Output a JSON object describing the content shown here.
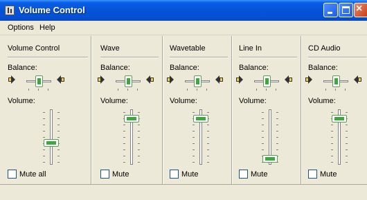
{
  "window": {
    "title": "Volume Control",
    "accent": "#0a5fe6",
    "icon": "speaker-app-icon"
  },
  "menu": {
    "items": [
      "Options",
      "Help"
    ]
  },
  "labels": {
    "balance": "Balance:",
    "volume": "Volume:"
  },
  "channels": [
    {
      "name": "Volume Control",
      "balance": 0.5,
      "volume": 0.38,
      "mute_label": "Mute all",
      "muted": false
    },
    {
      "name": "Wave",
      "balance": 0.5,
      "volume": 0.88,
      "mute_label": "Mute",
      "muted": false
    },
    {
      "name": "Wavetable",
      "balance": 0.5,
      "volume": 0.88,
      "mute_label": "Mute",
      "muted": false
    },
    {
      "name": "Line In",
      "balance": 0.5,
      "volume": 0.05,
      "mute_label": "Mute",
      "muted": false
    },
    {
      "name": "CD Audio",
      "balance": 0.5,
      "volume": 0.88,
      "mute_label": "Mute",
      "muted": false
    }
  ]
}
